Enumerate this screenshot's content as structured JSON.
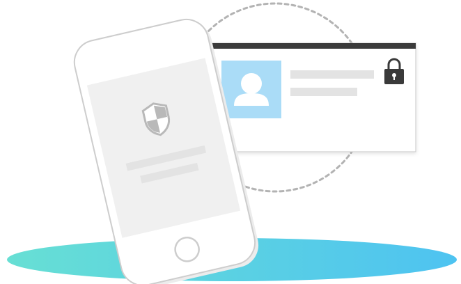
{
  "illustration": {
    "icons": [
      "shield-icon",
      "user-avatar-icon",
      "padlock-icon",
      "home-button"
    ],
    "colors": {
      "floor_gradient_start": "#67dfd4",
      "floor_gradient_end": "#4ec3f1",
      "avatar_background": "#aadcf7",
      "card_top_bar": "#3a3a3a",
      "padlock": "#3a3a3a",
      "dashed_circle": "#b3b3b3",
      "phone_body": "#ffffff",
      "phone_screen": "#f0f0f0",
      "placeholder_bar": "#e3e3e3",
      "shield": "#b9b9b9"
    }
  }
}
